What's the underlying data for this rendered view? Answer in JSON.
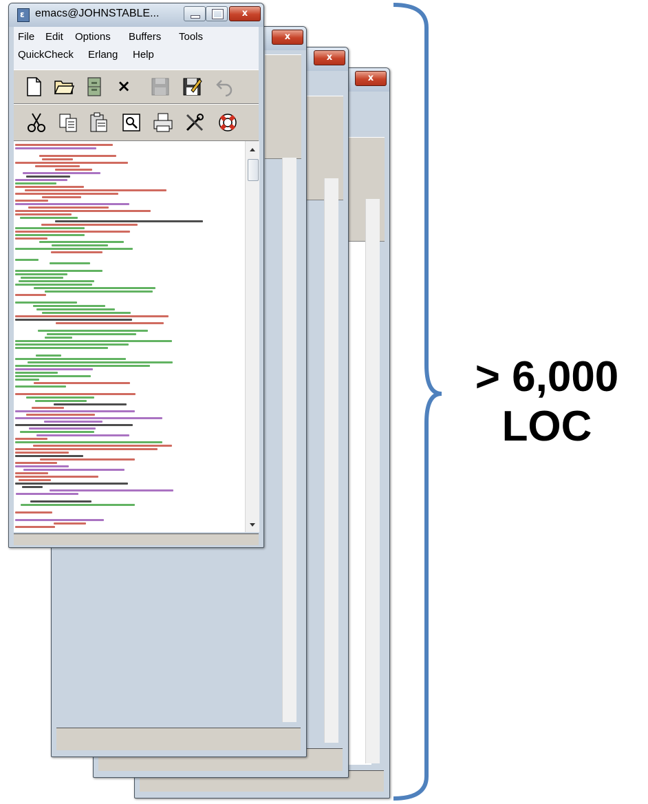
{
  "window": {
    "title": "emacs@JOHNSTABLE...",
    "close_glyph": "x",
    "icon": "emacs-icon"
  },
  "menu": {
    "row1": [
      "File",
      "Edit",
      "Options",
      "Buffers",
      "Tools"
    ],
    "row2": [
      "QuickCheck",
      "Erlang",
      "Help"
    ]
  },
  "toolbar": {
    "row1_icons": [
      "new-file-icon",
      "open-folder-icon",
      "file-cabinet-icon",
      "close-x-icon",
      "save-disk-icon",
      "save-as-icon",
      "undo-icon"
    ],
    "row2_icons": [
      "cut-scissors-icon",
      "copy-icon",
      "paste-icon",
      "search-icon",
      "print-icon",
      "preferences-tools-icon",
      "help-lifebuoy-icon"
    ],
    "close_glyph": "×"
  },
  "annotation": {
    "line1": "> 6,000",
    "line2": "LOC"
  },
  "colors": {
    "brace": "#4f81bd",
    "code_comment": "#c0392b",
    "code_keyword": "#8e44ad",
    "code_green": "#2e9a2e",
    "code_black": "#111111"
  }
}
